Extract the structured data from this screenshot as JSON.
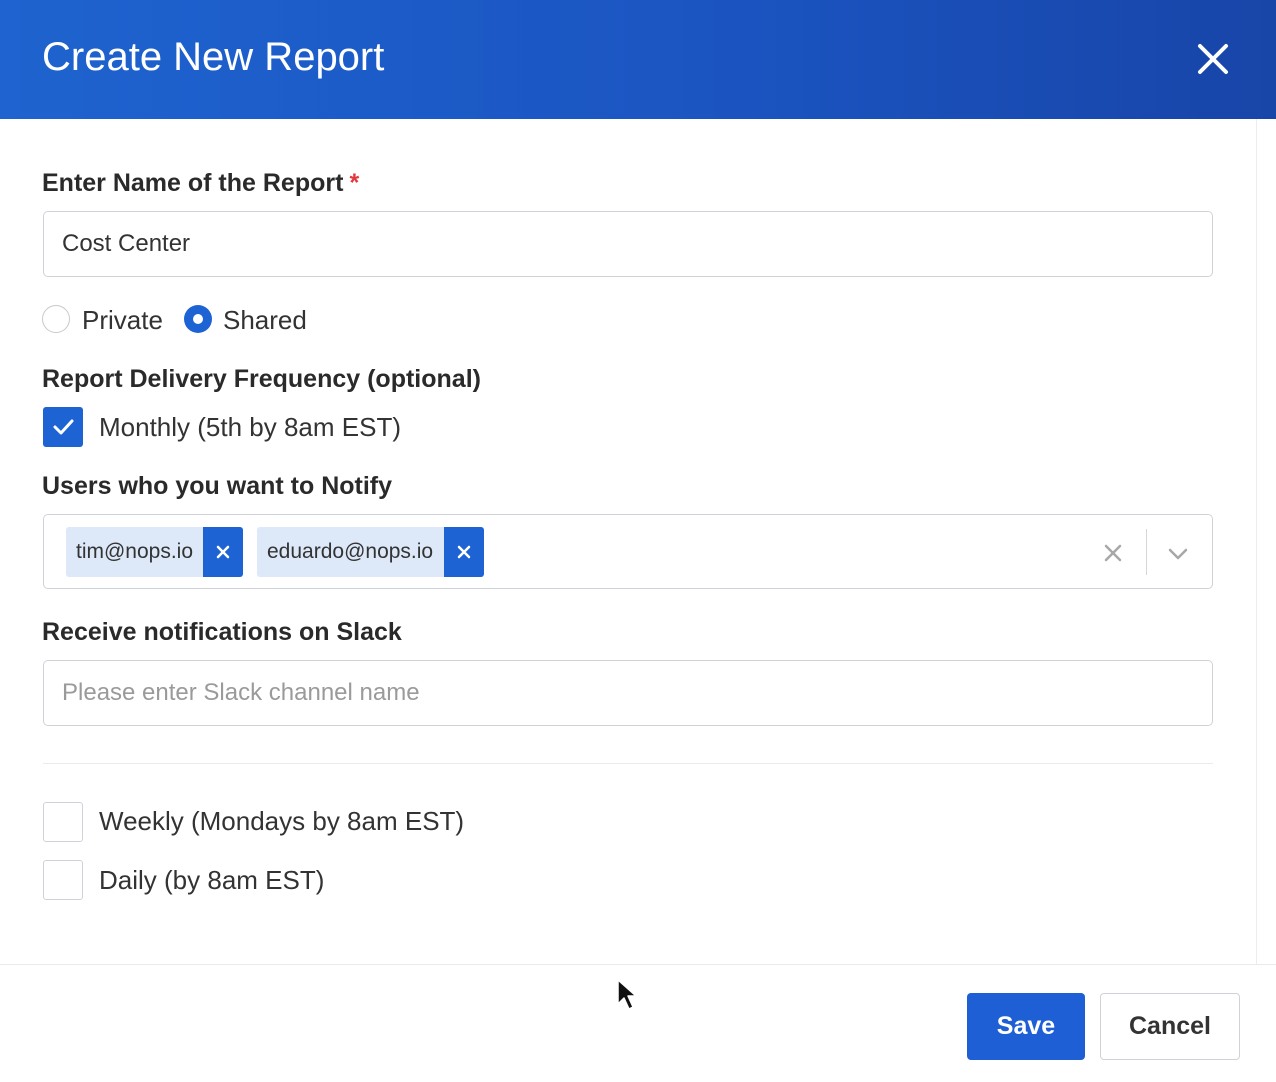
{
  "dialog": {
    "title": "Create New Report"
  },
  "report_name": {
    "label": "Enter Name of the Report",
    "required_mark": "*",
    "value": "Cost Center"
  },
  "visibility": {
    "options": [
      {
        "label": "Private",
        "selected": false
      },
      {
        "label": "Shared",
        "selected": true
      }
    ]
  },
  "frequency": {
    "label": "Report Delivery Frequency (optional)",
    "monthly": {
      "label": "Monthly (5th by 8am EST)",
      "checked": true
    },
    "weekly": {
      "label": "Weekly (Mondays by 8am EST)",
      "checked": false
    },
    "daily": {
      "label": "Daily (by 8am EST)",
      "checked": false
    }
  },
  "notify": {
    "label": "Users who you want to Notify",
    "users": [
      "tim@nops.io",
      "eduardo@nops.io"
    ]
  },
  "slack": {
    "label": "Receive notifications on Slack",
    "placeholder": "Please enter Slack channel name",
    "value": ""
  },
  "footer": {
    "save_label": "Save",
    "cancel_label": "Cancel"
  },
  "colors": {
    "header": "#1e63cf",
    "accent": "#1e63d4",
    "tag_bg": "#dde8f8"
  }
}
